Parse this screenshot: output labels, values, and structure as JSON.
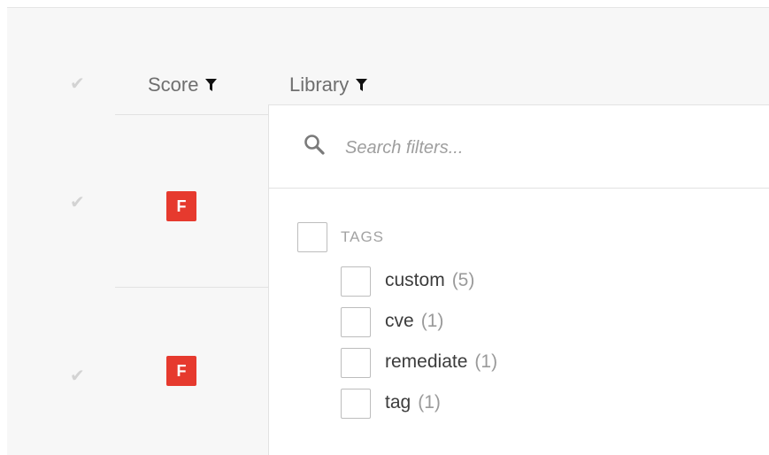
{
  "table": {
    "columns": [
      {
        "label": "Score",
        "icon": "filter-icon"
      },
      {
        "label": "Library",
        "icon": "filter-icon"
      }
    ],
    "rows": [
      {
        "grade": "F"
      },
      {
        "grade": "F"
      }
    ]
  },
  "filter_dropdown": {
    "search": {
      "placeholder": "Search filters...",
      "value": ""
    },
    "group": {
      "label": "TAGS"
    },
    "options": [
      {
        "label": "custom",
        "count": "(5)"
      },
      {
        "label": "cve",
        "count": "(1)"
      },
      {
        "label": "remediate",
        "count": "(1)"
      },
      {
        "label": "tag",
        "count": "(1)"
      }
    ]
  },
  "colors": {
    "grade_fail": "#e63a2e",
    "background": "#f7f7f7"
  }
}
